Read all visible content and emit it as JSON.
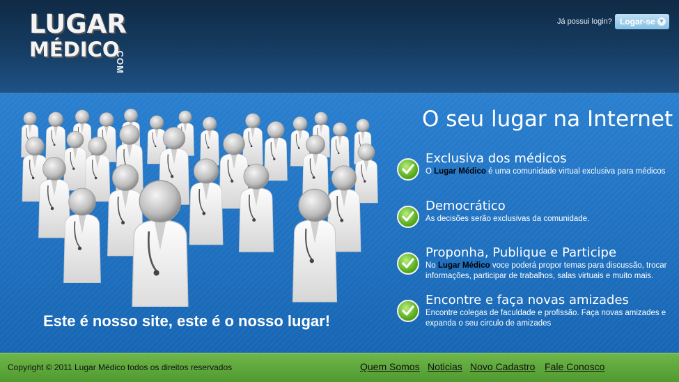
{
  "header": {
    "logo_line1": "LUGAR",
    "logo_line2": "MÉDICO",
    "logo_com": ".COM",
    "login_question": "Já possui login?",
    "login_button": "Logar-se"
  },
  "hero": {
    "headline": "O seu lugar na Internet",
    "tagline": "Este é nosso site, este é o nosso lugar!",
    "features": [
      {
        "title": "Exclusiva dos médicos",
        "desc_pre": "O ",
        "desc_bold": "Lugar Médico",
        "desc_post": " é uma comunidade virtual exclusiva para médicos"
      },
      {
        "title": "Democrático",
        "desc_pre": "As decisões serão exclusivas da comunidade.",
        "desc_bold": "",
        "desc_post": ""
      },
      {
        "title": "Proponha, Publique e Participe",
        "desc_pre": "No ",
        "desc_bold": "Lugar Médico",
        "desc_post": " voce poderá propor temas para discussão, trocar informações, participar de trabalhos, salas virtuais e muito mais."
      },
      {
        "title": "Encontre e faça novas amizades",
        "desc_pre": "Encontre colegas de faculdade e profissão. Faça novas amizades e expanda o seu circulo de amizades",
        "desc_bold": "",
        "desc_post": ""
      }
    ]
  },
  "footer": {
    "copyright": "Copyright © 2011 Lugar Médico todos os direitos reservados",
    "links": [
      "Quem Somos",
      "Noticias",
      "Novo Cadastro",
      "Fale Conosco"
    ]
  },
  "colors": {
    "header_dark": "#0f2a45",
    "main_blue": "#2a7fcf",
    "footer_green": "#5fa83c",
    "login_button": "#9fd0ee",
    "check_green": "#5aad20"
  },
  "icons": {
    "feature_icon": "check-circle-icon",
    "login_chevron": "chevron-down-icon",
    "illustration": "doctors-crowd-illustration"
  }
}
